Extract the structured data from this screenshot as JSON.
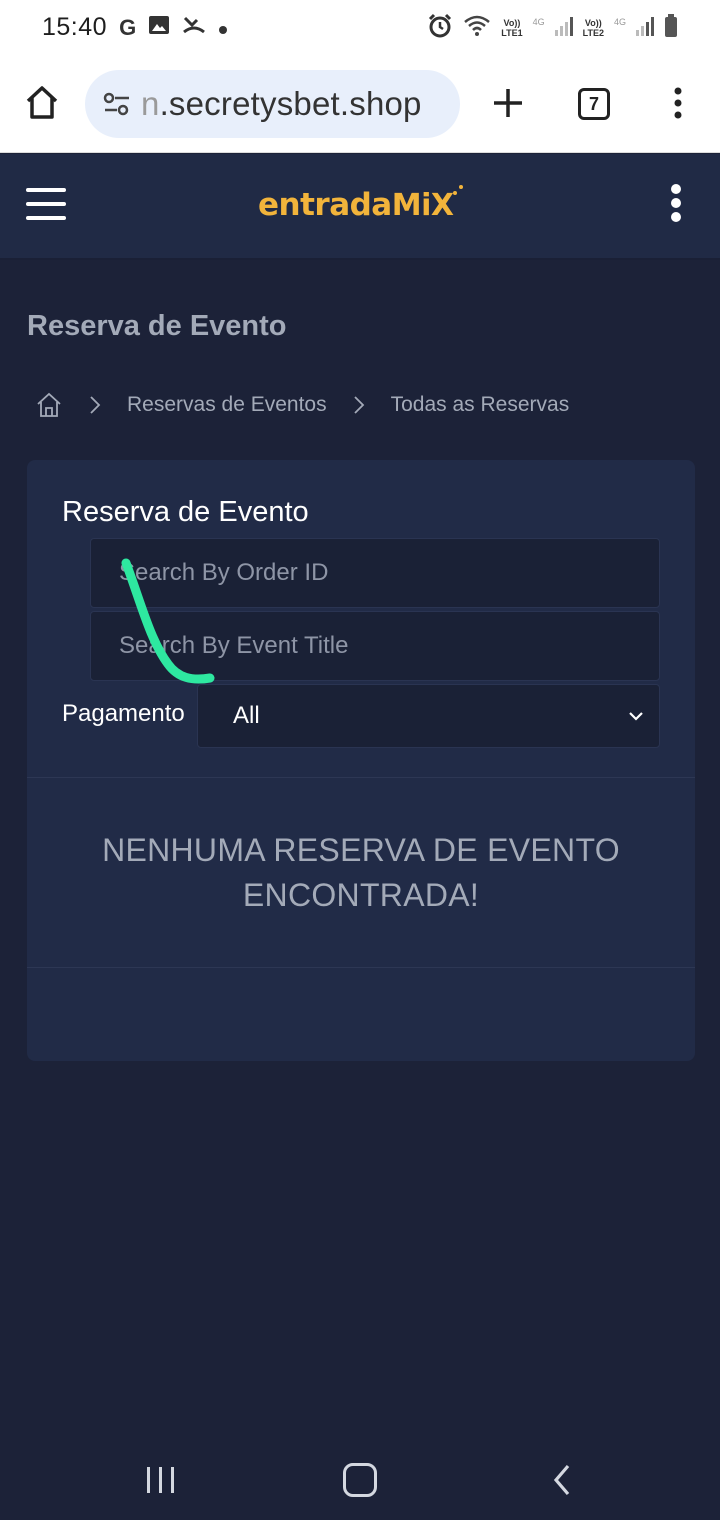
{
  "status_bar": {
    "time": "15:40",
    "icons_left": [
      "google-g-icon",
      "image-icon",
      "missed-call-icon",
      "dot-icon"
    ],
    "icons_right": [
      "alarm-icon",
      "wifi-icon",
      "signal-icon",
      "battery-icon"
    ],
    "sim1_top": "Vo))",
    "sim1_bottom": "LTE1",
    "sim2_top": "Vo))",
    "sim2_bottom": "LTE2",
    "net_badge": "4G",
    "g_letter": "G"
  },
  "browser": {
    "url_prefix": "n",
    "url_main": ".secretysbet.shop",
    "tab_count": "7"
  },
  "site": {
    "logo_part1": "entrada",
    "logo_part2": "MiX",
    "logo_color": "#f2b43b"
  },
  "page": {
    "title": "Reserva de Evento",
    "breadcrumb": [
      "Reservas de Eventos",
      "Todas as Reservas"
    ]
  },
  "card": {
    "title": "Reserva de Evento",
    "search_order_placeholder": "Search By Order ID",
    "search_event_placeholder": "Search By Event Title",
    "payment_label": "Pagamento",
    "payment_selected": "All",
    "empty_line1": "NENHUMA RESERVA DE EVENTO",
    "empty_line2": "ENCONTRADA!"
  },
  "colors": {
    "background": "#1c2238",
    "card": "#212b47",
    "annotation_stroke": "#2ee8a0"
  }
}
